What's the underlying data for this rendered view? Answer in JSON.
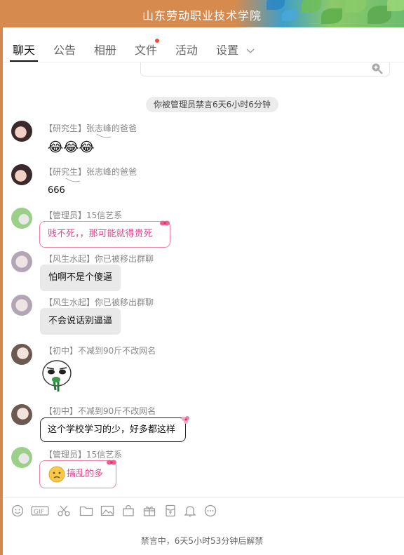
{
  "window": {
    "title": "山东劳动职业技术学院"
  },
  "tabs": [
    {
      "label": "聊天"
    },
    {
      "label": "公告"
    },
    {
      "label": "相册"
    },
    {
      "label": "文件"
    },
    {
      "label": "活动"
    },
    {
      "label": "设置"
    }
  ],
  "system_notice": "你被管理员禁言6天6小时6分钟",
  "messages": [
    {
      "rank": "【研究生】",
      "sender": "张志峰的爸爸",
      "text": "😂😂😂"
    },
    {
      "rank": "【研究生】",
      "sender": "张志峰的爸爸",
      "text": "666"
    },
    {
      "rank": "【管理员】",
      "sender": "15信艺系",
      "text": "贱不死，，那可能就得贵死"
    },
    {
      "rank": "【风生水起】",
      "sender": "你已被移出群聊",
      "text": "怕啊不是个傻逼"
    },
    {
      "rank": "【风生水起】",
      "sender": "你已被移出群聊",
      "text": "不会说话别逼逼"
    },
    {
      "rank": "【初中】",
      "sender": "不减到90斤不改网名",
      "text": ""
    },
    {
      "rank": "【初中】",
      "sender": "不减到90斤不改网名",
      "text": "这个学校学习的少，好多都这样"
    },
    {
      "rank": "【管理员】",
      "sender": "15信艺系",
      "text": "搞乱的多"
    }
  ],
  "toolbar_icons": [
    "emoji-icon",
    "gif-icon",
    "scissors-icon",
    "folder-icon",
    "image-icon",
    "gift-bag-icon",
    "gift-icon",
    "red-packet-icon",
    "bell-icon",
    "more-icon"
  ],
  "footer": {
    "mute_status": "禁言中，6天5小时53分钟后解禁"
  },
  "colors": {
    "accent_pink": "#ef7fa6",
    "notification_dot": "#ee4d3e",
    "title_bar": "#d78a4e"
  }
}
